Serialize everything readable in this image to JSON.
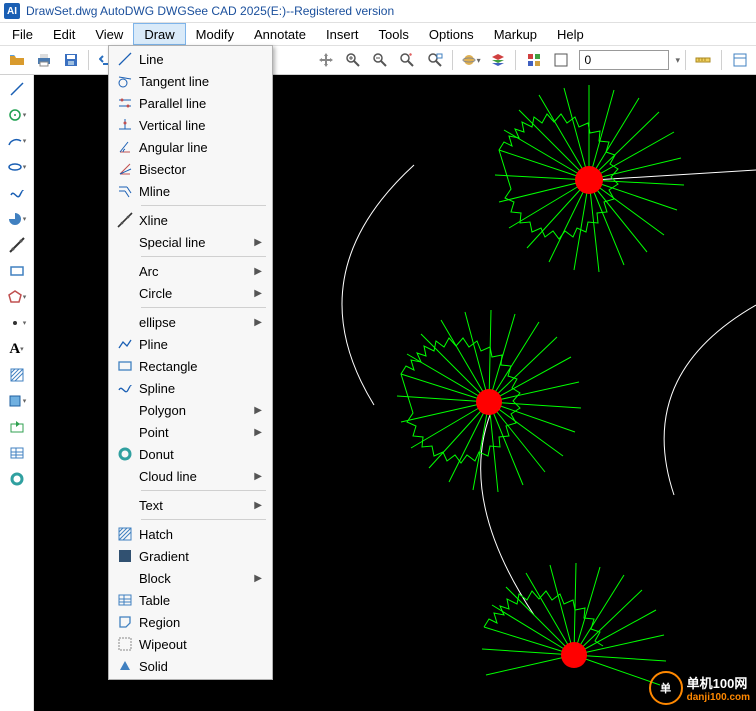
{
  "title": "DrawSet.dwg AutoDWG DWGSee CAD 2025(E:)--Registered version",
  "app_icon": "AI",
  "menubar": [
    "File",
    "Edit",
    "View",
    "Draw",
    "Modify",
    "Annotate",
    "Insert",
    "Tools",
    "Options",
    "Markup",
    "Help"
  ],
  "active_menu": 3,
  "layer_value": "0",
  "draw_menu": {
    "group1": [
      {
        "icon": "line",
        "label": "Line"
      },
      {
        "icon": "tangent",
        "label": "Tangent line"
      },
      {
        "icon": "parallel",
        "label": "Parallel line"
      },
      {
        "icon": "vertical",
        "label": "Vertical line"
      },
      {
        "icon": "angular",
        "label": "Angular line"
      },
      {
        "icon": "bisector",
        "label": "Bisector"
      },
      {
        "icon": "mline",
        "label": "Mline"
      }
    ],
    "group2": [
      {
        "icon": "xline",
        "label": "Xline"
      },
      {
        "label": "Special  line",
        "sub": true
      }
    ],
    "group3": [
      {
        "label": "Arc",
        "sub": true
      },
      {
        "label": "Circle",
        "sub": true
      }
    ],
    "group4": [
      {
        "label": "ellipse",
        "sub": true
      },
      {
        "icon": "pline",
        "label": "Pline"
      },
      {
        "icon": "rect",
        "label": "Rectangle"
      },
      {
        "icon": "spline",
        "label": "Spline"
      },
      {
        "label": "Polygon",
        "sub": true
      },
      {
        "label": "Point",
        "sub": true
      },
      {
        "icon": "donut",
        "label": "Donut"
      },
      {
        "label": "Cloud line",
        "sub": true
      }
    ],
    "group5": [
      {
        "label": "Text",
        "sub": true
      }
    ],
    "group6": [
      {
        "icon": "hatch",
        "label": "Hatch"
      },
      {
        "icon": "gradient",
        "label": "Gradient"
      },
      {
        "label": "Block",
        "sub": true
      },
      {
        "icon": "table",
        "label": "Table"
      },
      {
        "icon": "region",
        "label": "Region"
      },
      {
        "icon": "wipeout",
        "label": "Wipeout"
      },
      {
        "icon": "solid",
        "label": "Solid"
      }
    ]
  },
  "watermark": {
    "text": "单机100网",
    "url": "danji100.com"
  }
}
